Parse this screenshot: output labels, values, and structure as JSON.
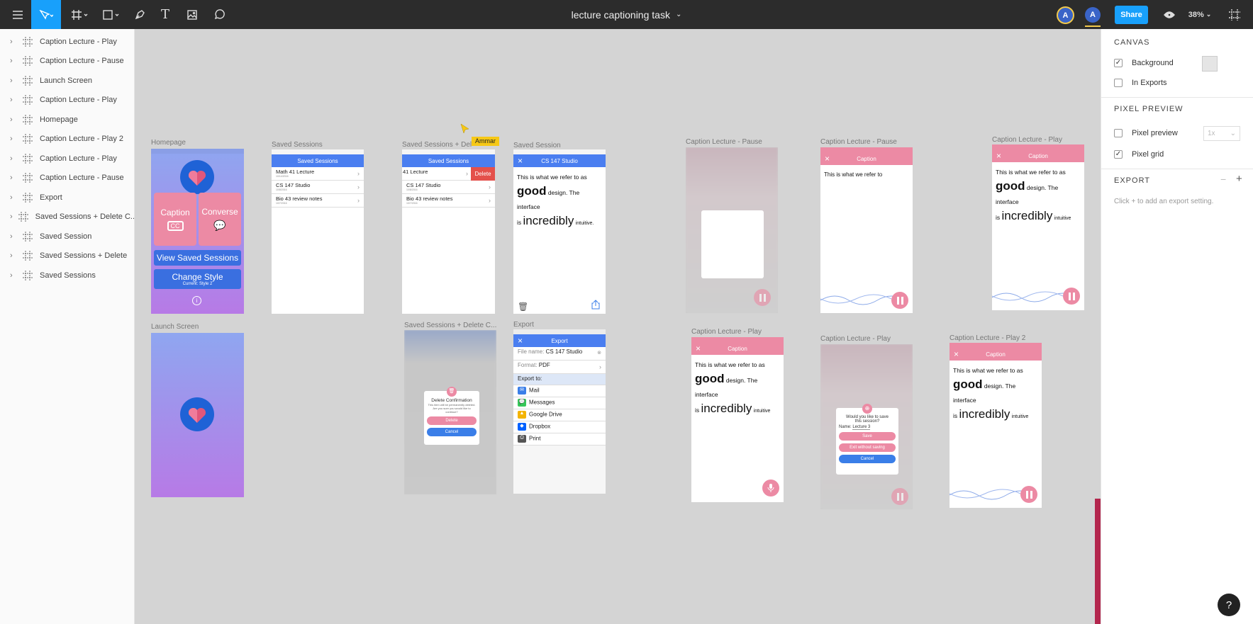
{
  "toolbar": {
    "title": "lecture captioning task",
    "share_label": "Share",
    "zoom": "38%",
    "avatar1": "A",
    "avatar2": "A"
  },
  "layers": [
    "Caption Lecture - Play",
    "Caption Lecture - Pause",
    "Launch Screen",
    "Caption Lecture - Play",
    "Homepage",
    "Caption Lecture - Play 2",
    "Caption Lecture - Play",
    "Caption Lecture - Pause",
    "Export",
    "Saved Sessions + Delete C...",
    "Saved Session",
    "Saved Sessions + Delete",
    "Saved Sessions"
  ],
  "frame_labels": {
    "homepage": "Homepage",
    "saved_sessions": "Saved Sessions",
    "saved_sessions_delete": "Saved Sessions + Del",
    "saved_session": "Saved Session",
    "pause1": "Caption Lecture - Pause",
    "pause2": "Caption Lecture - Pause",
    "play1": "Caption Lecture - Play",
    "launch": "Launch Screen",
    "delete_confirm": "Saved Sessions + Delete C...",
    "export": "Export",
    "play2": "Caption Lecture - Play",
    "play3": "Caption Lecture - Play",
    "play_2": "Caption Lecture - Play 2"
  },
  "cursor_user": "Ammar",
  "homepage": {
    "caption": "Caption",
    "cc": "CC",
    "converse": "Converse",
    "view_saved": "View Saved Sessions",
    "change_style": "Change Style",
    "current_style": "Current: Style 2"
  },
  "saved_sessions": {
    "title": "Saved Sessions",
    "items": [
      {
        "name": "Math 41 Lecture",
        "date": "10/14/2016"
      },
      {
        "name": "CS 147 Studio",
        "date": "10/8/2016"
      },
      {
        "name": "Bio 43 review notes",
        "date": "10/7/2016"
      }
    ]
  },
  "saved_delete": {
    "title": "Saved Sessions",
    "first_item": "41 Lecture",
    "delete": "Delete"
  },
  "session": {
    "title": "CS 147 Studio",
    "line1": "This is what we refer to as",
    "good": "good",
    "line2": "design. The interface",
    "is": "is",
    "incredibly": "incredibly",
    "intuitive_dot": "intuitive.",
    "intuitive": "intuitive"
  },
  "caption_nav": "Caption",
  "pause_text": "This is what we refer to",
  "save_dialog": {
    "q1": "Would you like to save",
    "q2": "this session?",
    "name_label": "Name:",
    "name_value": "Lecture 3",
    "save": "Save",
    "exit": "Exit without saving",
    "cancel": "Cancel"
  },
  "delete_dialog": {
    "title": "Delete Confirmation",
    "body": "This item will be permanently deleted. Are you sure you would like to continue?",
    "delete": "Delete",
    "cancel": "Cancel"
  },
  "export": {
    "title": "Export",
    "file_name_label": "File name:",
    "file_name": "CS 147 Studio",
    "format_label": "Format:",
    "format": "PDF",
    "export_to": "Export to:",
    "targets": [
      "Mail",
      "Messages",
      "Google Drive",
      "Dropbox",
      "Print"
    ]
  },
  "right_panel": {
    "canvas": "CANVAS",
    "background": "Background",
    "in_exports": "In Exports",
    "pixel_preview_section": "PIXEL PREVIEW",
    "pixel_preview": "Pixel preview",
    "pixel_preview_value": "1x",
    "pixel_grid": "Pixel grid",
    "export": "EXPORT",
    "export_hint": "Click + to add an export setting."
  },
  "help": "?",
  "colors": {
    "accent": "#18a0fb",
    "pink": "#ec8aa4",
    "blue": "#4a7ef0"
  }
}
